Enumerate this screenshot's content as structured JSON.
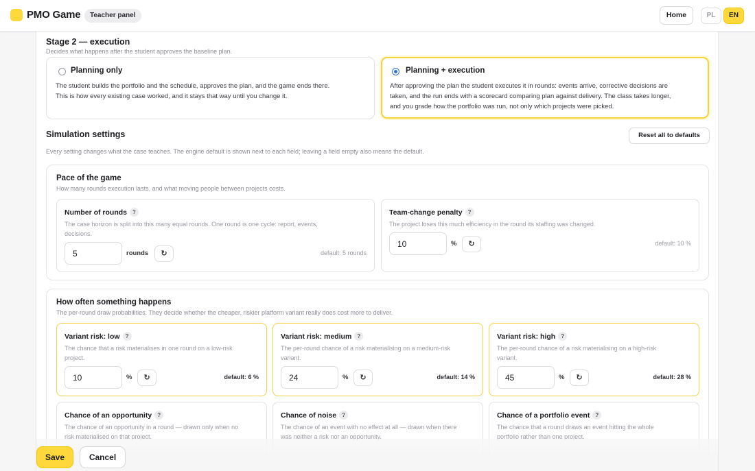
{
  "topbar": {
    "app_title": "PMO Game",
    "panel_badge": "Teacher panel",
    "home_label": "Home",
    "lang_pl": "PL",
    "lang_en": "EN",
    "active_lang": "EN"
  },
  "stage2": {
    "title": "Stage 2 — execution",
    "subtitle": "Decides what happens after the student approves the baseline plan.",
    "options": [
      {
        "title": "Planning only",
        "selected": false,
        "body_lines": [
          "The student builds the portfolio and the schedule, approves the plan, and the game ends there.",
          "This is how every existing case worked, and it stays that way until you change it."
        ]
      },
      {
        "title": "Planning + execution",
        "selected": true,
        "body_lines": [
          "After approving the plan the student executes it in rounds: events arrive, corrective decisions are",
          "taken, and the run ends with a scorecard comparing plan against delivery. The class takes longer,",
          "and you grade how the portfolio was run, not only which projects were picked."
        ]
      }
    ]
  },
  "simulation": {
    "title": "Simulation settings",
    "subtitle": "Every setting changes what the case teaches. The engine default is shown next to each field; leaving a field empty also means the default.",
    "reset_all_label": "Reset all to defaults"
  },
  "pace": {
    "title": "Pace of the game",
    "subtitle": "How many rounds execution lasts, and what moving people between projects costs.",
    "fields": [
      {
        "title": "Number of rounds",
        "help": "?",
        "desc_lines": [
          "The case horizon is split into this many equal rounds. One round is one cycle: report, events,",
          "decisions."
        ],
        "value": "5",
        "unit": "rounds",
        "reset_icon": "↻",
        "default": "default: 5 rounds"
      },
      {
        "title": "Team-change penalty",
        "help": "?",
        "desc_lines": [
          "The project loses this much efficiency in the round its staffing was changed."
        ],
        "value": "10",
        "unit": "%",
        "reset_icon": "↻",
        "default": "default: 10 %"
      }
    ]
  },
  "happens": {
    "title": "How often something happens",
    "subtitle": "The per-round draw probabilities. They decide whether the cheaper, riskier platform variant really does cost more to deliver.",
    "fields": [
      {
        "title": "Variant risk: low",
        "help": "?",
        "desc_lines": [
          "The chance that a risk materialises in one round on a low-risk",
          "project."
        ],
        "value": "10",
        "unit": "%",
        "reset_icon": "↻",
        "default": "default: 6 %"
      },
      {
        "title": "Variant risk: medium",
        "help": "?",
        "desc_lines": [
          "The per-round chance of a risk materialising on a medium-risk",
          "variant."
        ],
        "value": "24",
        "unit": "%",
        "reset_icon": "↻",
        "default": "default: 14 %"
      },
      {
        "title": "Variant risk: high",
        "help": "?",
        "desc_lines": [
          "The per-round chance of a risk materialising on a high-risk",
          "variant."
        ],
        "value": "45",
        "unit": "%",
        "reset_icon": "↻",
        "default": "default: 28 %"
      },
      {
        "title": "Chance of an opportunity",
        "help": "?",
        "desc_lines": [
          "The chance of an opportunity in a round — drawn only when no",
          "risk materialised on that project."
        ]
      },
      {
        "title": "Chance of noise",
        "help": "?",
        "desc_lines": [
          "The chance of an event with no effect at all — drawn when there",
          "was neither a risk nor an opportunity."
        ]
      },
      {
        "title": "Chance of a portfolio event",
        "help": "?",
        "desc_lines": [
          "The chance that a round draws an event hitting the whole",
          "portfolio rather than one project."
        ]
      }
    ]
  },
  "footer": {
    "save_label": "Save",
    "cancel_label": "Cancel"
  },
  "colors": {
    "accent_yellow": "#ffd93b",
    "radio_blue": "#2f6fe0"
  }
}
